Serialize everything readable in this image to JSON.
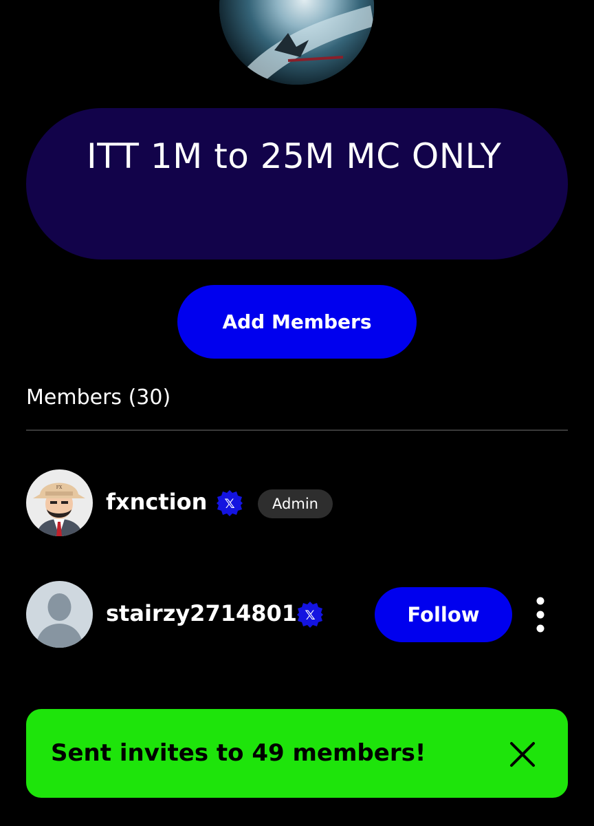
{
  "group": {
    "name": "ITT 1M to 25M MC ONLY",
    "avatar_icon": "group-avatar-image"
  },
  "actions": {
    "add_members_label": "Add Members"
  },
  "members": {
    "heading": "Members (30)",
    "list": [
      {
        "username": "fxnction",
        "verified_icon": "x-logo-badge-icon",
        "role_badge": "Admin",
        "avatar_icon": "cartoon-avatar"
      },
      {
        "username": "stairzy2714801",
        "verified_icon": "x-logo-badge-icon",
        "follow_label": "Follow",
        "more_icon": "more-vertical-icon",
        "avatar_icon": "default-user-avatar"
      }
    ]
  },
  "toast": {
    "message": "Sent invites to 49 members!",
    "close_icon": "close-icon"
  },
  "colors": {
    "background": "#000000",
    "group_pill": "#12034a",
    "accent_blue": "#0000ee",
    "toast_green": "#1ee40b",
    "admin_badge": "#2e2e2e",
    "divider": "#3a3a3a"
  }
}
